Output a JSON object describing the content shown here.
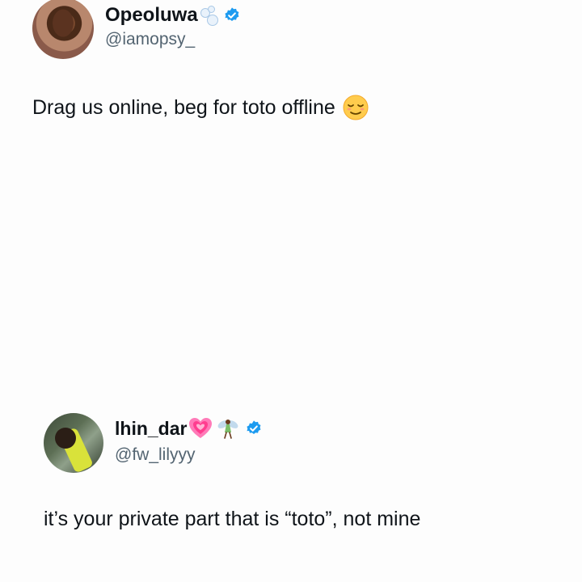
{
  "tweet_main": {
    "display_name": "Opeoluwa",
    "handle": "@iamopsy_",
    "text": "Drag us online, beg for toto offline",
    "name_icons": [
      "bubbles-icon",
      "verified-badge-icon"
    ],
    "text_emoji": "relieved-face-icon"
  },
  "tweet_reply": {
    "display_name": "lhin_dar",
    "handle": "@fw_lilyyy",
    "text": "it’s your private part that is “toto”, not mine",
    "name_icons": [
      "growing-heart-icon",
      "fairy-icon",
      "verified-badge-icon"
    ]
  },
  "colors": {
    "verified_blue": "#1d9bf0",
    "handle_gray": "#536471",
    "text": "#0f1419",
    "heart_pink": "#ff5fa8"
  }
}
